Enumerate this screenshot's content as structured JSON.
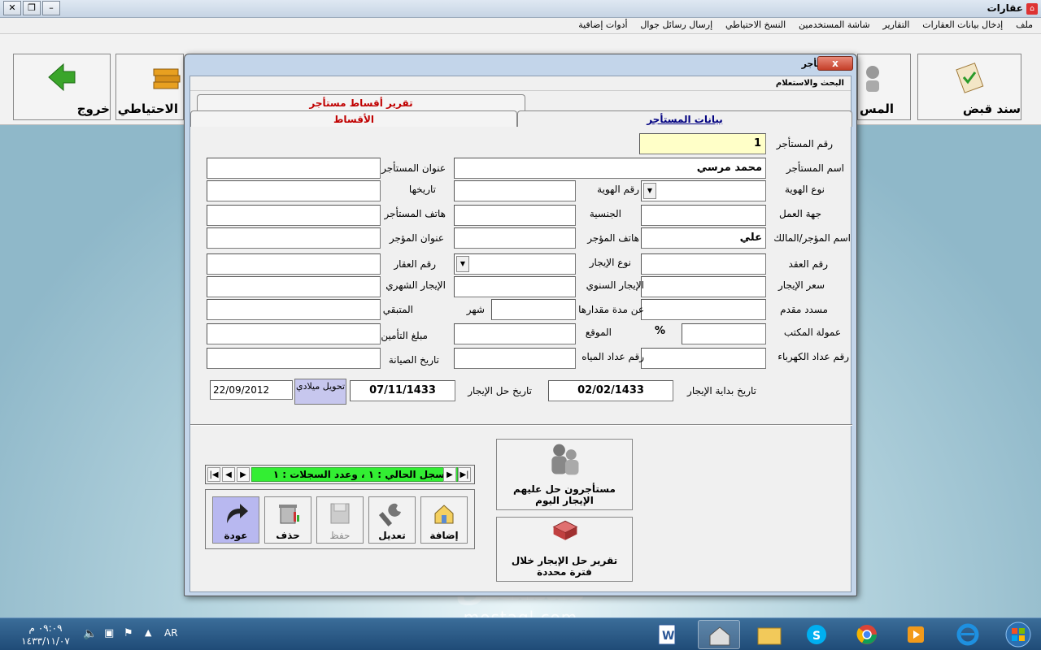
{
  "app": {
    "title": "عقارات"
  },
  "menu": [
    "ملف",
    "إدخال بيانات العقارات",
    "التقارير",
    "شاشة المستخدمين",
    "النسخ الاحتياطي",
    "إرسال رسائل جوال",
    "أدوات إضافية"
  ],
  "toolbar": {
    "receipt": "سند قبض",
    "tenant": "المس",
    "backup": "الاحتياطي",
    "exit": "خروج"
  },
  "dialog": {
    "title": "مستأجر",
    "close": "x",
    "subbar": "البحث والاستعلام",
    "tabs": {
      "installments_report": "تقرير أقساط مستأجر",
      "installments": "الأقساط",
      "tenant_data": "بيانات المستأجر"
    }
  },
  "form": {
    "labels": {
      "tenant_no": "رقم المستأجر",
      "tenant_name": "اسم المستأجر",
      "tenant_address": "عنوان المستأجر",
      "id_type": "نوع الهوية",
      "id_no": "رقم الهوية",
      "id_date": "تاريخها",
      "workplace": "جهة العمل",
      "nationality": "الجنسية",
      "tenant_phone": "هاتف المستأجر",
      "owner_name": "اسم المؤجر/المالك",
      "owner_phone": "هاتف المؤجر",
      "owner_address": "عنوان المؤجر",
      "contract_no": "رقم العقد",
      "rent_type": "نوع الإيجار",
      "property_no": "رقم العقار",
      "rent_price": "سعر الإيجار",
      "annual_rent": "الإيجار السنوي",
      "monthly_rent": "الإيجار الشهري",
      "paid_advance": "مسدد مقدم",
      "period_for": "عن مدة مقدارها",
      "month": "شهر",
      "remaining": "المتبقي",
      "office_commission": "عمولة المكتب",
      "percent": "%",
      "location": "الموقع",
      "insurance": "مبلغ التأمين",
      "electricity_meter": "رقم عداد الكهرباء",
      "water_meter": "رقم عداد المياه",
      "maintenance_date": "تاريخ الصيانة",
      "rent_start": "تاريخ بداية الإيجار",
      "rent_due": "تاريخ حل الإيجار"
    },
    "values": {
      "tenant_no": "1",
      "tenant_name": "محمد مرسي",
      "owner_name": "علي",
      "rent_start": "02/02/1433",
      "rent_due": "07/11/1433",
      "gregorian": "22/09/2012"
    },
    "convert_button": "تحويل ميلادي"
  },
  "navigator": {
    "status": "السجل الحالي : ١ ، وعدد السجلات : ١",
    "first": "|◀",
    "prev": "◀",
    "next": "▶",
    "last": "▶|"
  },
  "actions": {
    "add": "إضافة",
    "edit": "تعديل",
    "save": "حفظ",
    "delete": "حذف",
    "back": "عودة"
  },
  "reports": {
    "due_today": "مستأجرون حل عليهم الإيجار اليوم",
    "due_period": "تقرير حل الإيجار خلال فترة محددة"
  },
  "watermark": {
    "arabic": "مستقل",
    "latin": "mostaql.com"
  },
  "taskbar": {
    "lang": "AR",
    "time": "٠٩:٠٩ م",
    "date": "١٤٣٣/١١/٠٧"
  },
  "colors": {
    "highlight_field": "#ffffc8",
    "status_green": "#33ee33",
    "tab_red": "#c00000",
    "back_button": "#b8b8f0"
  }
}
